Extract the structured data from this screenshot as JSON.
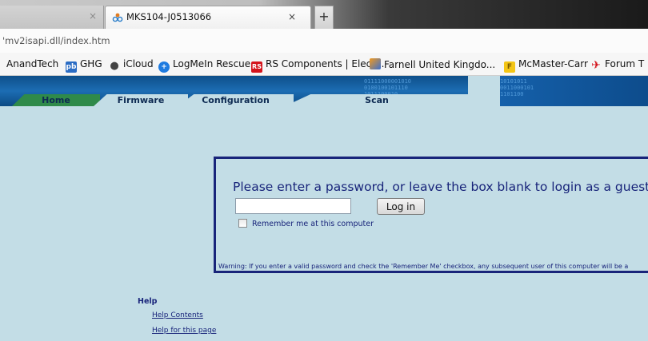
{
  "browser": {
    "tabs": [
      {
        "title": ""
      },
      {
        "title": "MKS104-J0513066"
      }
    ],
    "close_glyph": "×",
    "new_tab_glyph": "+",
    "url": "'mv2isapi.dll/index.htm"
  },
  "bookmarks": [
    {
      "label": "AnandTech",
      "icon": ""
    },
    {
      "label": "GHG",
      "icon": "pb-icon"
    },
    {
      "label": "iCloud",
      "icon": "apple-icon"
    },
    {
      "label": "LogMeIn Rescue",
      "icon": "logmein-icon"
    },
    {
      "label": "RS Components | Elect...",
      "icon": "rs-icon",
      "badge": "RS"
    },
    {
      "label": "Farnell United Kingdo...",
      "icon": "farnell-icon"
    },
    {
      "label": "McMaster-Carr",
      "icon": "mcmaster-icon",
      "badge": "F"
    },
    {
      "label": "Forum T",
      "icon": "plane-icon"
    }
  ],
  "nav": {
    "tabs": [
      {
        "label": "Home"
      },
      {
        "label": "Firmware"
      },
      {
        "label": "Configuration"
      },
      {
        "label": "Scan"
      }
    ]
  },
  "login": {
    "prompt": "Please enter a password, or leave the box blank to login as a guest",
    "password_value": "",
    "button_label": "Log in",
    "remember_label": "Remember me at this computer",
    "remember_checked": false,
    "warning": "Warning: If you enter a valid password and check the 'Remember Me' checkbox, any subsequent user of this computer will be a"
  },
  "help": {
    "title": "Help",
    "links": [
      {
        "label": "Help Contents"
      },
      {
        "label": "Help for this page"
      }
    ]
  },
  "colors": {
    "page_bg": "#c3dde6",
    "text_navy": "#18247a",
    "banner_blue": "#1c6db3",
    "home_tab_green": "#2f8a4a"
  }
}
